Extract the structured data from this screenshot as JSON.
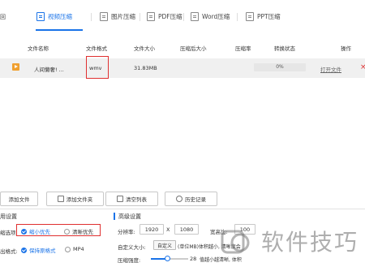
{
  "nav": {
    "back_label": "回",
    "tabs": [
      {
        "label": "视频压缩",
        "active": true
      },
      {
        "label": "图片压缩",
        "active": false
      },
      {
        "label": "PDF压缩",
        "active": false
      },
      {
        "label": "Word压缩",
        "active": false
      },
      {
        "label": "PPT压缩",
        "active": false
      }
    ]
  },
  "table": {
    "headers": [
      "文件名称",
      "文件格式",
      "文件大小",
      "压缩后大小",
      "压缩率",
      "转换状态",
      "操作"
    ],
    "rows": [
      {
        "name": "人间懒奢! ...",
        "format": "wmv",
        "size": "31.83MB",
        "compressed_size": "",
        "ratio": "",
        "progress": "0%",
        "progress_value": 0,
        "action": "打开文件"
      }
    ]
  },
  "toolbar": {
    "add_file": "添加文件",
    "add_folder": "添加文件夹",
    "clear_list": "清空列表",
    "history": "历史记录"
  },
  "general": {
    "title": "用设置",
    "quality_label": "缩选项:",
    "option_small": "缩小优先",
    "option_clear": "清晰优先",
    "format_label": "出格式:",
    "option_keep": "保持原格式",
    "option_mp4": "MP4"
  },
  "advanced": {
    "title": "高级设置",
    "resolution_label": "分辨率:",
    "width": "1920",
    "times": "X",
    "height": "1080",
    "aspect_label": "宽高比:",
    "aspect_value": "100",
    "custom_size_label": "自定义大小:",
    "custom_button": "自定义",
    "custom_hint": "(单位MB)体积越小, 清晰度会",
    "strength_label": "压缩强度:",
    "strength_value": "28",
    "strength_hint": "值越小越清晰, 体积",
    "strength_fraction": 0.45
  },
  "watermark": {
    "text": "软件技巧"
  },
  "colors": {
    "accent": "#1a73e8",
    "highlight_box": "#e03030",
    "file_icon": "#f0a030"
  }
}
